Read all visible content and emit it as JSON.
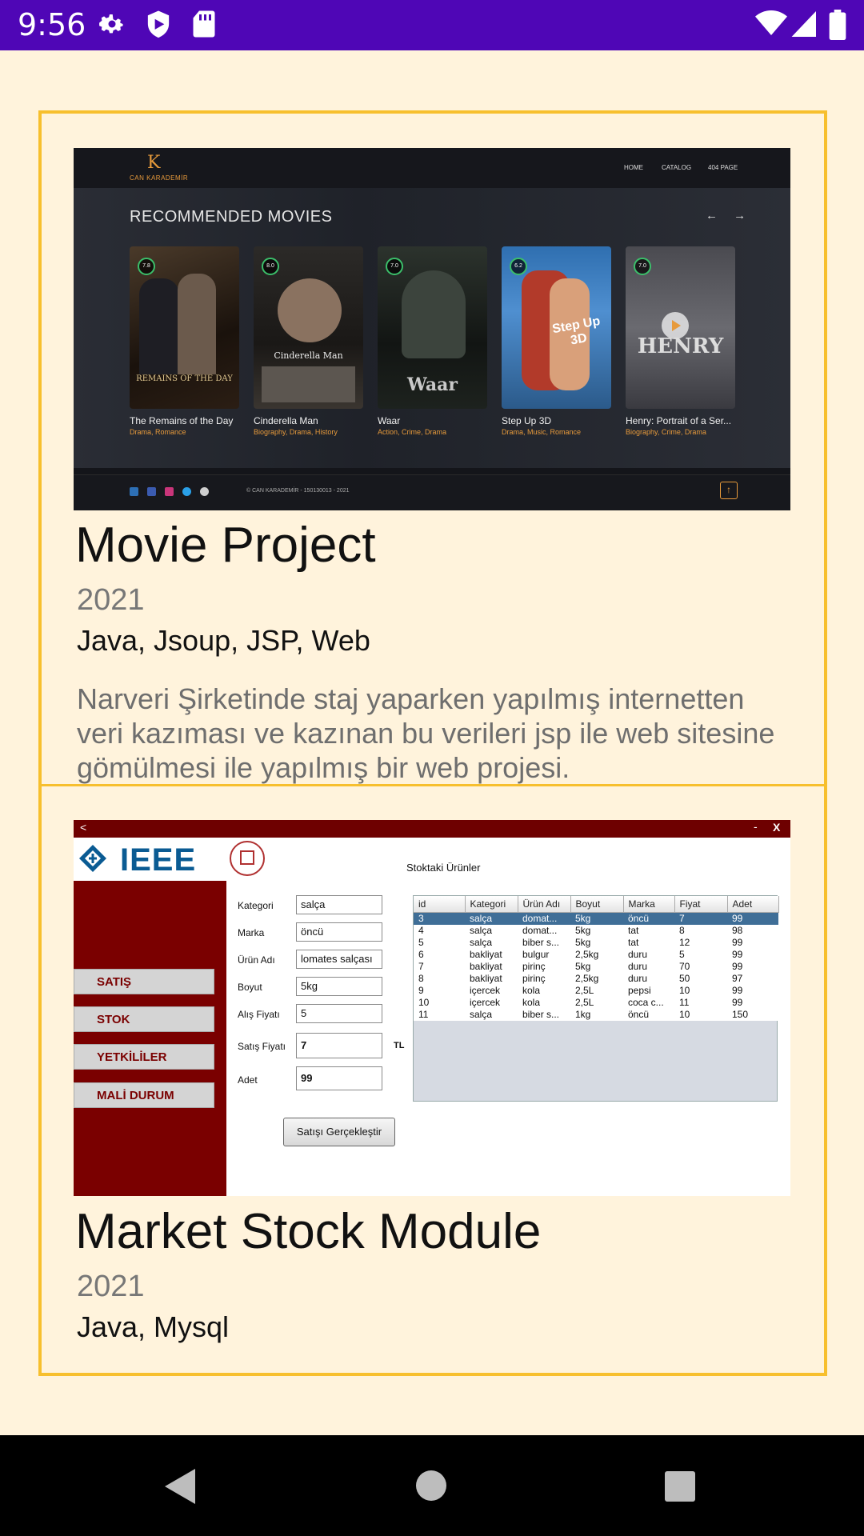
{
  "status_bar": {
    "time": "9:56",
    "icons": [
      "settings-icon",
      "play-protect-icon",
      "sd-card-icon",
      "wifi-icon",
      "signal-icon",
      "battery-icon"
    ]
  },
  "projects": [
    {
      "title": "Movie Project",
      "year": "2021",
      "tech": "Java, Jsoup, JSP, Web",
      "description": "Narveri Şirketinde staj yaparken yapılmış internetten veri kazıması ve kazınan bu verileri jsp ile web sitesine gömülmesi ile yapılmış bir web projesi.",
      "screenshot": {
        "logo_letter": "K",
        "logo_text": "CAN KARADEMİR",
        "nav": [
          "HOME",
          "CATALOG",
          "404 PAGE"
        ],
        "heading": "RECOMMENDED MOVIES",
        "arrows": "← →",
        "movies": [
          {
            "rating": "7.8",
            "title": "The Remains of the Day",
            "genre": "Drama, Romance"
          },
          {
            "rating": "8.0",
            "title": "Cinderella Man",
            "genre": "Biography, Drama, History"
          },
          {
            "rating": "7.0",
            "title": "Waar",
            "genre": "Action, Crime, Drama"
          },
          {
            "rating": "6.2",
            "title": "Step Up 3D",
            "genre": "Drama, Music, Romance"
          },
          {
            "rating": "7.0",
            "title": "Henry: Portrait of a Ser...",
            "genre": "Biography, Crime, Drama"
          }
        ],
        "poster_captions": [
          "REMAINS OF THE DAY",
          "Cinderella Man",
          "Waar",
          "Step Up 3D",
          "HENRY"
        ],
        "footer_copy": "© CAN KARADEMİR - 150130013 - 2021",
        "up_glyph": "↑"
      }
    },
    {
      "title": "Market Stock Module",
      "year": "2021",
      "tech": "Java, Mysql",
      "screenshot": {
        "back": "<",
        "min": "-",
        "close": "X",
        "logo_text": "IEEE",
        "table_title": "Stoktaki Ürünler",
        "menu": [
          "SATIŞ",
          "STOK",
          "YETKİLİLER",
          "MALİ DURUM"
        ],
        "form": [
          {
            "label": "Kategori",
            "value": "salça"
          },
          {
            "label": "Marka",
            "value": "öncü"
          },
          {
            "label": "Ürün Adı",
            "value": "lomates salçası"
          },
          {
            "label": "Boyut",
            "value": "5kg"
          },
          {
            "label": "Alış Fiyatı",
            "value": "5"
          },
          {
            "label": "Satış Fiyatı",
            "value": "7"
          },
          {
            "label": "Adet",
            "value": "99"
          }
        ],
        "currency": "TL",
        "sell_button": "Satışı Gerçekleştir",
        "columns": [
          "id",
          "Kategori",
          "Ürün Adı",
          "Boyut",
          "Marka",
          "Fiyat",
          "Adet"
        ],
        "rows": [
          [
            "3",
            "salça",
            "domat...",
            "5kg",
            "öncü",
            "7",
            "99"
          ],
          [
            "4",
            "salça",
            "domat...",
            "5kg",
            "tat",
            "8",
            "98"
          ],
          [
            "5",
            "salça",
            "biber s...",
            "5kg",
            "tat",
            "12",
            "99"
          ],
          [
            "6",
            "bakliyat",
            "bulgur",
            "2,5kg",
            "duru",
            "5",
            "99"
          ],
          [
            "7",
            "bakliyat",
            "pirinç",
            "5kg",
            "duru",
            "70",
            "99"
          ],
          [
            "8",
            "bakliyat",
            "pirinç",
            "2,5kg",
            "duru",
            "50",
            "97"
          ],
          [
            "9",
            "içercek",
            "kola",
            "2,5L",
            "pepsi",
            "10",
            "99"
          ],
          [
            "10",
            "içercek",
            "kola",
            "2,5L",
            "coca c...",
            "11",
            "99"
          ],
          [
            "11",
            "salça",
            "biber s...",
            "1kg",
            "öncü",
            "10",
            "150"
          ]
        ],
        "selected_row": 0
      }
    }
  ],
  "colors": {
    "status_bar": "#4f06b6",
    "background": "#fff3dc",
    "card_border": "#f7bf2e",
    "market_accent": "#7a0000"
  }
}
